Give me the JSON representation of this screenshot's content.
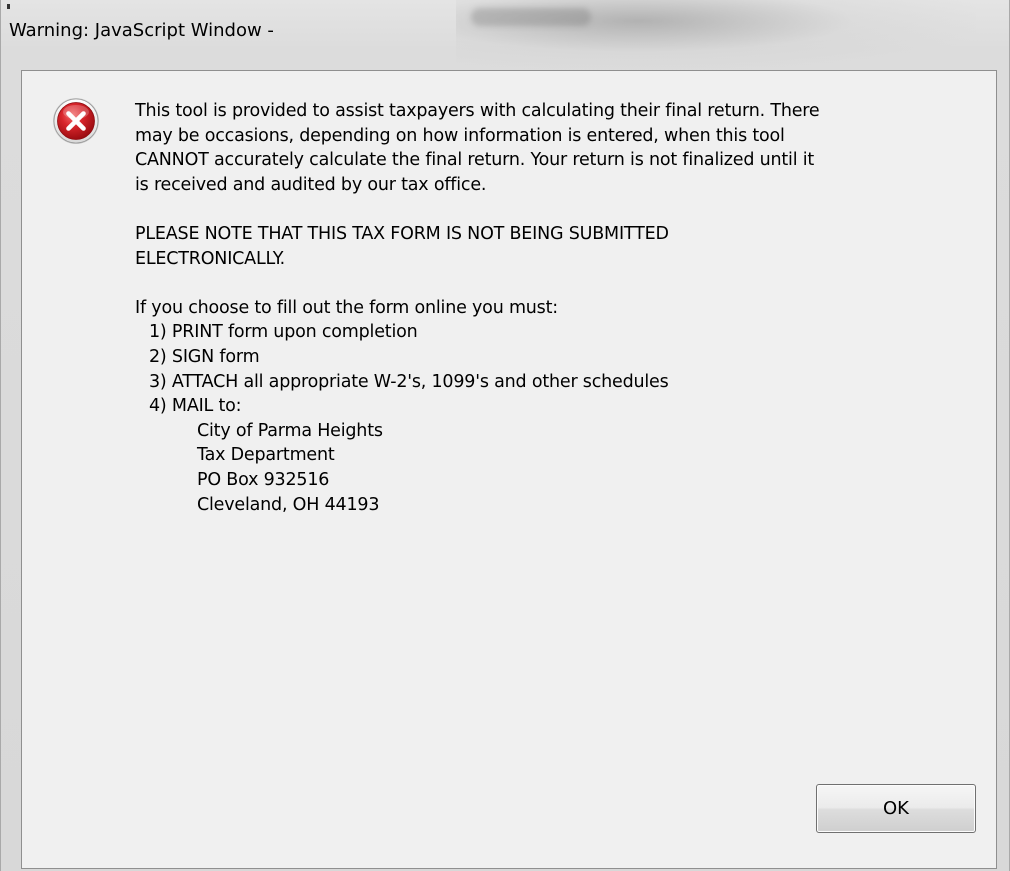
{
  "window": {
    "title": "Warning: JavaScript Window -"
  },
  "dialog": {
    "icon": "error-icon",
    "paragraph1": [
      "This tool is provided to assist taxpayers with calculating their final return. There",
      "may be occasions, depending on how information is entered, when this tool",
      "CANNOT accurately calculate the final return. Your return is not finalized until it",
      "is received and audited by our tax office."
    ],
    "paragraph2": [
      "PLEASE NOTE THAT THIS TAX FORM IS NOT BEING SUBMITTED",
      "ELECTRONICALLY."
    ],
    "instructions_intro": "If you choose to fill out the form online you must:",
    "steps": [
      "1) PRINT form upon completion",
      "2) SIGN form",
      "3) ATTACH all appropriate W-2's, 1099's and other schedules",
      "4) MAIL to:"
    ],
    "address": [
      "City of Parma Heights",
      "Tax Department",
      "PO Box 932516",
      "Cleveland, OH 44193"
    ],
    "ok_label": "OK"
  },
  "colors": {
    "icon_red": "#c9151b",
    "client_background": "#f0f0f0",
    "frame_background": "#dcdcdc"
  }
}
